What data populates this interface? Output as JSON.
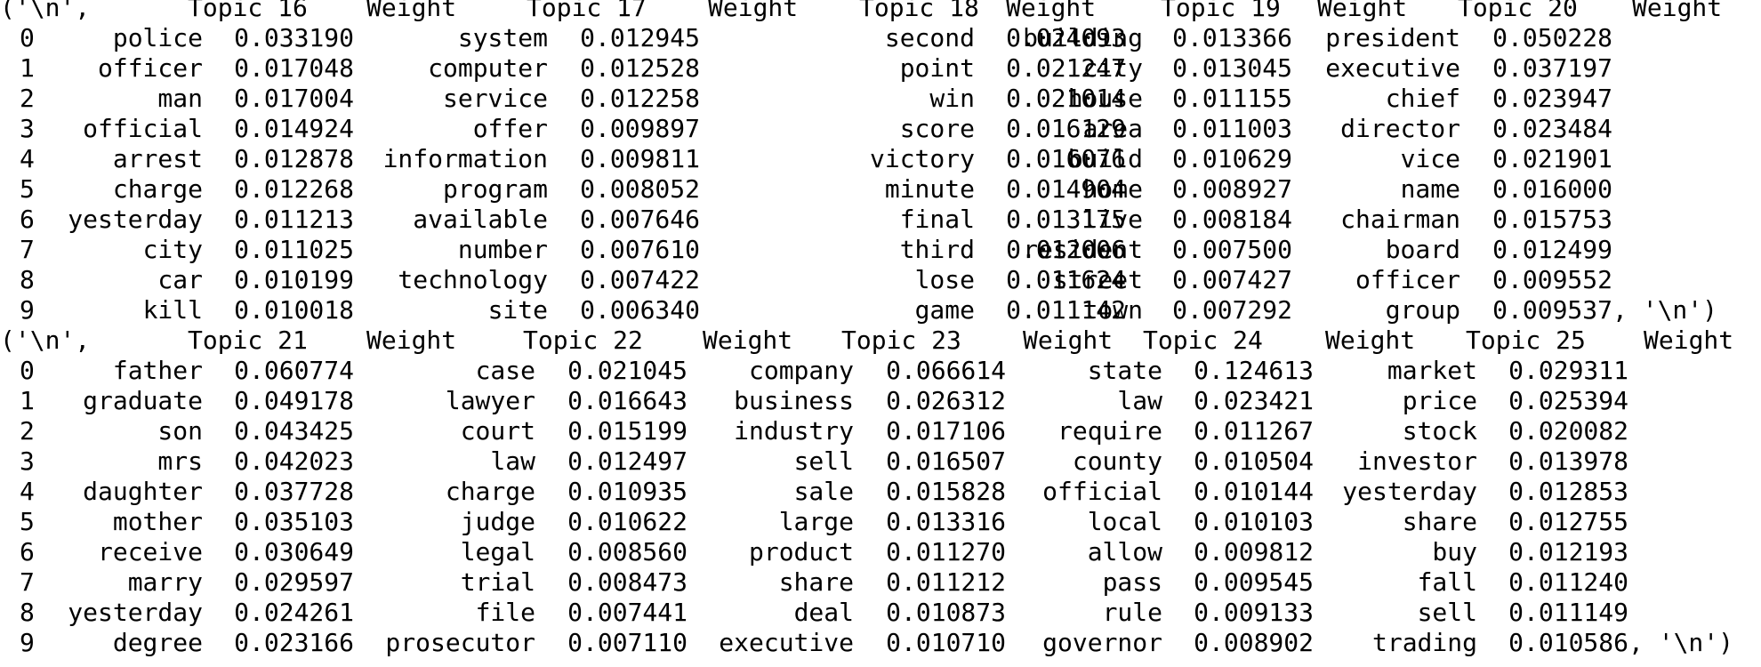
{
  "background": "#ffffff",
  "text_color": "#000000",
  "output_blocks": [
    {
      "header": {
        "open": "('\\n',",
        "labels": [
          "Topic 16",
          "Weight",
          "Topic 17",
          "Weight",
          "Topic 18",
          "Weight",
          "Topic 19",
          "Weight",
          "Topic 20",
          "Weight"
        ]
      },
      "rows": [
        {
          "index": "0",
          "cells": [
            "police",
            "0.033190",
            "system",
            "0.012945",
            "second",
            "0.024093",
            "building",
            "0.013366",
            "president",
            "0.050228"
          ],
          "tail": ""
        },
        {
          "index": "1",
          "cells": [
            "officer",
            "0.017048",
            "computer",
            "0.012528",
            "point",
            "0.021247",
            "city",
            "0.013045",
            "executive",
            "0.037197"
          ],
          "tail": ""
        },
        {
          "index": "2",
          "cells": [
            "man",
            "0.017004",
            "service",
            "0.012258",
            "win",
            "0.021014",
            "house",
            "0.011155",
            "chief",
            "0.023947"
          ],
          "tail": ""
        },
        {
          "index": "3",
          "cells": [
            "official",
            "0.014924",
            "offer",
            "0.009897",
            "score",
            "0.016129",
            "area",
            "0.011003",
            "director",
            "0.023484"
          ],
          "tail": ""
        },
        {
          "index": "4",
          "cells": [
            "arrest",
            "0.012878",
            "information",
            "0.009811",
            "victory",
            "0.016076",
            "build",
            "0.010629",
            "vice",
            "0.021901"
          ],
          "tail": ""
        },
        {
          "index": "5",
          "cells": [
            "charge",
            "0.012268",
            "program",
            "0.008052",
            "minute",
            "0.014904",
            "home",
            "0.008927",
            "name",
            "0.016000"
          ],
          "tail": ""
        },
        {
          "index": "6",
          "cells": [
            "yesterday",
            "0.011213",
            "available",
            "0.007646",
            "final",
            "0.013175",
            "live",
            "0.008184",
            "chairman",
            "0.015753"
          ],
          "tail": ""
        },
        {
          "index": "7",
          "cells": [
            "city",
            "0.011025",
            "number",
            "0.007610",
            "third",
            "0.012006",
            "resident",
            "0.007500",
            "board",
            "0.012499"
          ],
          "tail": ""
        },
        {
          "index": "8",
          "cells": [
            "car",
            "0.010199",
            "technology",
            "0.007422",
            "lose",
            "0.011624",
            "street",
            "0.007427",
            "officer",
            "0.009552"
          ],
          "tail": ""
        },
        {
          "index": "9",
          "cells": [
            "kill",
            "0.010018",
            "site",
            "0.006340",
            "game",
            "0.011142",
            "town",
            "0.007292",
            "group",
            "0.009537"
          ],
          "tail": ", '\\n')"
        }
      ]
    },
    {
      "header": {
        "open": "('\\n',",
        "labels": [
          "Topic 21",
          "Weight",
          "Topic 22",
          "Weight",
          "Topic 23",
          "Weight",
          "Topic 24",
          "Weight",
          "Topic 25",
          "Weight"
        ]
      },
      "rows": [
        {
          "index": "0",
          "cells": [
            "father",
            "0.060774",
            "case",
            "0.021045",
            "company",
            "0.066614",
            "state",
            "0.124613",
            "market",
            "0.029311"
          ],
          "tail": ""
        },
        {
          "index": "1",
          "cells": [
            "graduate",
            "0.049178",
            "lawyer",
            "0.016643",
            "business",
            "0.026312",
            "law",
            "0.023421",
            "price",
            "0.025394"
          ],
          "tail": ""
        },
        {
          "index": "2",
          "cells": [
            "son",
            "0.043425",
            "court",
            "0.015199",
            "industry",
            "0.017106",
            "require",
            "0.011267",
            "stock",
            "0.020082"
          ],
          "tail": ""
        },
        {
          "index": "3",
          "cells": [
            "mrs",
            "0.042023",
            "law",
            "0.012497",
            "sell",
            "0.016507",
            "county",
            "0.010504",
            "investor",
            "0.013978"
          ],
          "tail": ""
        },
        {
          "index": "4",
          "cells": [
            "daughter",
            "0.037728",
            "charge",
            "0.010935",
            "sale",
            "0.015828",
            "official",
            "0.010144",
            "yesterday",
            "0.012853"
          ],
          "tail": ""
        },
        {
          "index": "5",
          "cells": [
            "mother",
            "0.035103",
            "judge",
            "0.010622",
            "large",
            "0.013316",
            "local",
            "0.010103",
            "share",
            "0.012755"
          ],
          "tail": ""
        },
        {
          "index": "6",
          "cells": [
            "receive",
            "0.030649",
            "legal",
            "0.008560",
            "product",
            "0.011270",
            "allow",
            "0.009812",
            "buy",
            "0.012193"
          ],
          "tail": ""
        },
        {
          "index": "7",
          "cells": [
            "marry",
            "0.029597",
            "trial",
            "0.008473",
            "share",
            "0.011212",
            "pass",
            "0.009545",
            "fall",
            "0.011240"
          ],
          "tail": ""
        },
        {
          "index": "8",
          "cells": [
            "yesterday",
            "0.024261",
            "file",
            "0.007441",
            "deal",
            "0.010873",
            "rule",
            "0.009133",
            "sell",
            "0.011149"
          ],
          "tail": ""
        },
        {
          "index": "9",
          "cells": [
            "degree",
            "0.023166",
            "prosecutor",
            "0.007110",
            "executive",
            "0.010710",
            "governor",
            "0.008902",
            "trading",
            "0.010586"
          ],
          "tail": ", '\\n')"
        }
      ]
    }
  ]
}
